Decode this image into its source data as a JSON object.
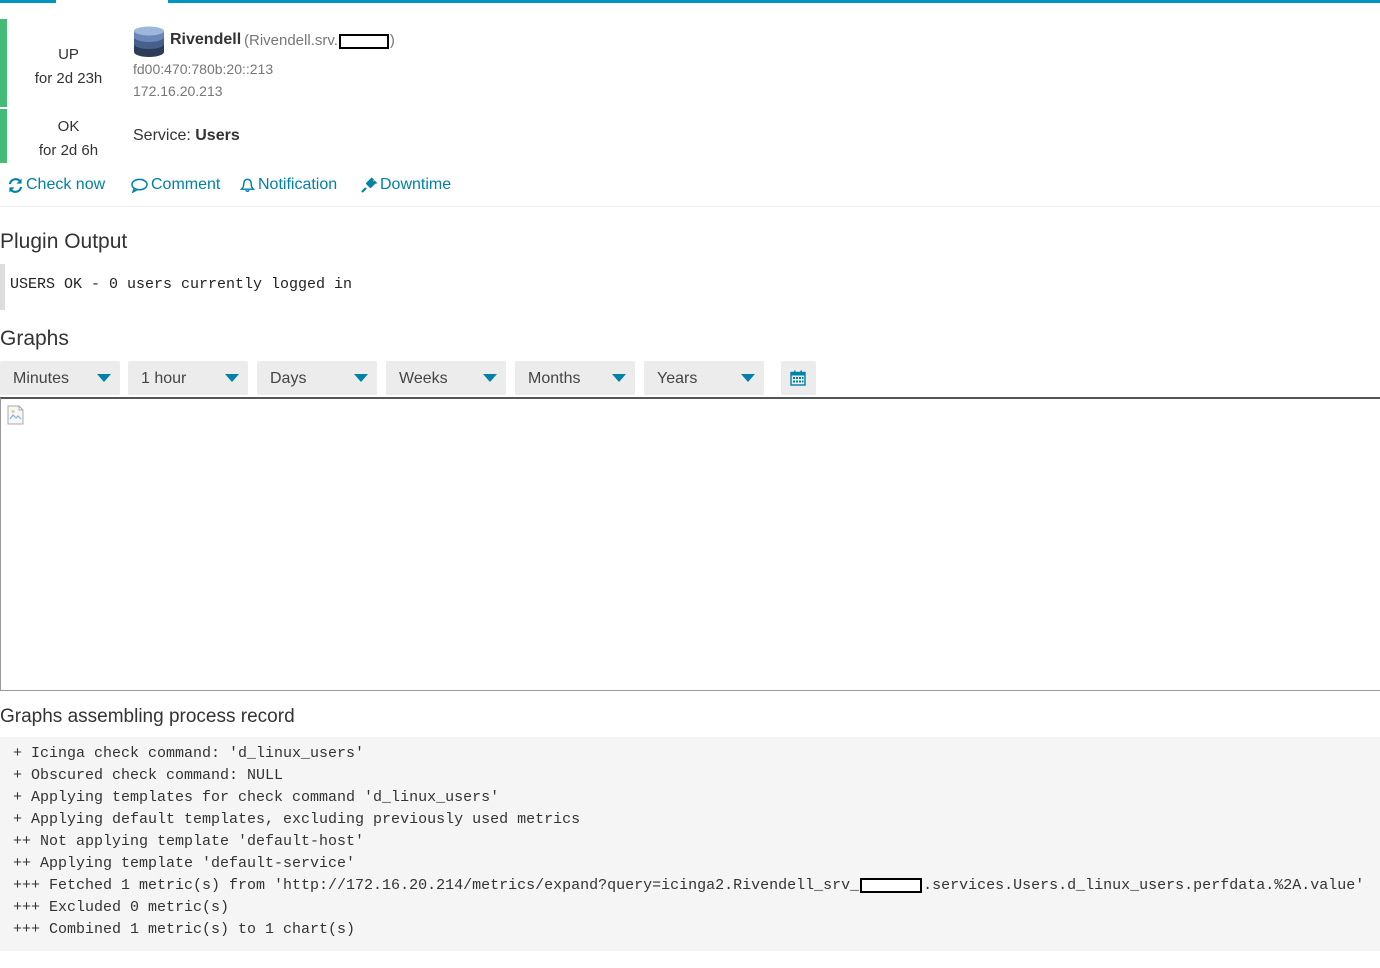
{
  "colors": {
    "accent": "#0081a7",
    "state_ok": "#44bb77",
    "topbar": "#0095bf"
  },
  "host": {
    "state": "UP",
    "state_duration": "for 2d 23h",
    "name": "Rivendell",
    "alias_prefix": "(Rivendell.srv.",
    "alias_suffix": ")",
    "ipv6": "fd00:470:780b:20::213",
    "ipv4": "172.16.20.213",
    "icon": "database-icon"
  },
  "service": {
    "state": "OK",
    "state_duration": "for 2d 6h",
    "label": "Service:",
    "name": "Users"
  },
  "actions": [
    {
      "label": "Check now",
      "icon": "refresh-icon"
    },
    {
      "label": "Comment",
      "icon": "comment-icon"
    },
    {
      "label": "Notification",
      "icon": "bell-icon"
    },
    {
      "label": "Downtime",
      "icon": "plug-icon"
    }
  ],
  "plugin_output": {
    "title": "Plugin Output",
    "text": "USERS OK - 0 users currently logged in"
  },
  "graphs": {
    "title": "Graphs",
    "selects": [
      "Minutes",
      "1 hour",
      "Days",
      "Weeks",
      "Months",
      "Years"
    ],
    "calendar_icon": "calendar-icon",
    "image_icon": "broken-image-icon"
  },
  "record": {
    "title": "Graphs assembling process record",
    "lines": [
      "+ Icinga check command: 'd_linux_users'",
      "+ Obscured check command: NULL",
      "+ Applying templates for check command 'd_linux_users'",
      "+ Applying default templates, excluding previously used metrics",
      "++ Not applying template 'default-host'",
      "++ Applying template 'default-service'",
      "+++ Excluded 0 metric(s)",
      "+++ Combined 1 metric(s) to 1 chart(s)"
    ],
    "fetched_prefix": "+++ Fetched 1 metric(s) from 'http://172.16.20.214/metrics/expand?query=icinga2.Rivendell_srv_",
    "fetched_suffix": ".services.Users.d_linux_users.perfdata.%2A.value'"
  }
}
